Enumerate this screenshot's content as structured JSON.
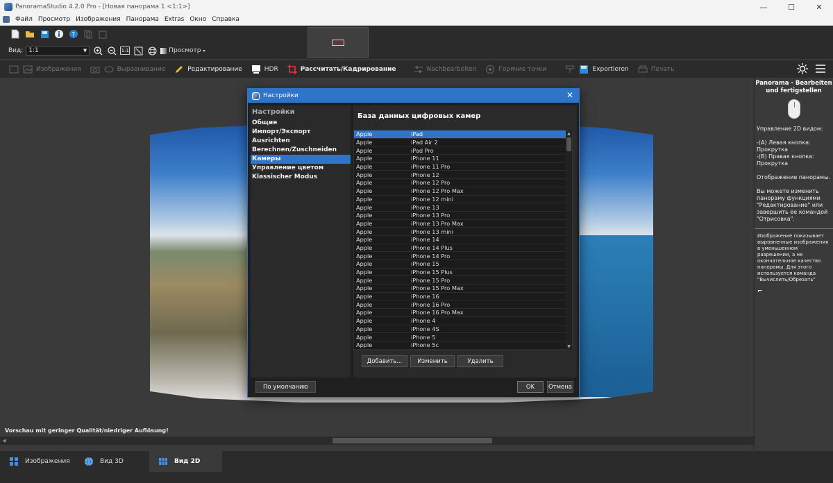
{
  "window": {
    "title": "PanoramaStudio 4.2.0 Pro - [Новая панорама 1 <1:1>]",
    "controls": {
      "minimize": "—",
      "maximize": "☐",
      "close": "✕"
    }
  },
  "menubar": {
    "items": [
      "Файл",
      "Просмотр",
      "Изображения",
      "Панорама",
      "Extras",
      "Окно",
      "Справка"
    ]
  },
  "toolbar1": {
    "view_label": "Вид:",
    "view_value": "1:1",
    "ratio_button": "1:1",
    "preview_label": "Просмотр"
  },
  "toolbar2": {
    "items": {
      "images": "Изображения",
      "align": "Выравнивание",
      "edit": "Редактирование",
      "hdr": "HDR",
      "compute": "Рассчитать/Кадрирование",
      "post": "Nachbearbeiten",
      "hotspots": "Горячие точки",
      "export": "Exportieren",
      "print": "Печать"
    }
  },
  "main": {
    "status": "Vorschau mit geringer Qualität/niedriger Auflösung!"
  },
  "right_panel": {
    "title": "Panorama - Bearbeiten und fertigstellen",
    "p1": "Управление 2D видом:",
    "p2a": "-(A) Левая кнопка:",
    "p2b": "Прокрутка",
    "p2c": "-(B) Правая кнопка:",
    "p2d": "Прокрутка",
    "p3": "Отображение панорамы.",
    "p4": "Вы можете изменить панораму функциями \"Редактирование\" или завершить ее командой \"Отрисовка\".",
    "note": "Изображение показывает выровненные изображения в уменьшенном разрешении, а не окончательное качество панорамы. Для этого используется команда \"Вычислить/Обрезать\"",
    "corner": "⌐"
  },
  "bottom_tabs": {
    "images": "Изображения",
    "view3d": "Вид 3D",
    "view2d": "Вид 2D"
  },
  "dialog": {
    "title": "Настройки",
    "sidebar_heading": "Настройки",
    "nav": [
      "Общие",
      "Импорт/Экспорт",
      "Ausrichten",
      "Berechnen/Zuschneiden",
      "Камеры",
      "Управление цветом",
      "Klassischer Modus"
    ],
    "content_heading": "База данных цифровых камер",
    "cameras": [
      [
        "Apple",
        "iPad"
      ],
      [
        "Apple",
        "iPad Air 2"
      ],
      [
        "Apple",
        "iPad Pro"
      ],
      [
        "Apple",
        "iPhone 11"
      ],
      [
        "Apple",
        "iPhone 11 Pro"
      ],
      [
        "Apple",
        "iPhone 12"
      ],
      [
        "Apple",
        "iPhone 12 Pro"
      ],
      [
        "Apple",
        "iPhone 12 Pro Max"
      ],
      [
        "Apple",
        "iPhone 12 mini"
      ],
      [
        "Apple",
        "iPhone 13"
      ],
      [
        "Apple",
        "iPhone 13 Pro"
      ],
      [
        "Apple",
        "iPhone 13 Pro Max"
      ],
      [
        "Apple",
        "iPhone 13 mini"
      ],
      [
        "Apple",
        "iPhone 14"
      ],
      [
        "Apple",
        "iPhone 14 Plus"
      ],
      [
        "Apple",
        "iPhone 14 Pro"
      ],
      [
        "Apple",
        "iPhone 15"
      ],
      [
        "Apple",
        "iPhone 15 Plus"
      ],
      [
        "Apple",
        "iPhone 15 Pro"
      ],
      [
        "Apple",
        "iPhone 15 Pro Max"
      ],
      [
        "Apple",
        "iPhone 16"
      ],
      [
        "Apple",
        "iPhone 16 Pro"
      ],
      [
        "Apple",
        "iPhone 16 Pro Max"
      ],
      [
        "Apple",
        "iPhone 4"
      ],
      [
        "Apple",
        "iPhone 4S"
      ],
      [
        "Apple",
        "iPhone 5"
      ],
      [
        "Apple",
        "iPhone 5c"
      ]
    ],
    "buttons": {
      "add": "Добавить...",
      "edit": "Изменить",
      "delete": "Удалить",
      "defaults": "По умолчанию",
      "ok": "OK",
      "cancel": "Отмена"
    }
  },
  "colors": {
    "accent": "#2e74c8",
    "background": "#3a3a3a",
    "toolbar": "#2b2b2b"
  }
}
